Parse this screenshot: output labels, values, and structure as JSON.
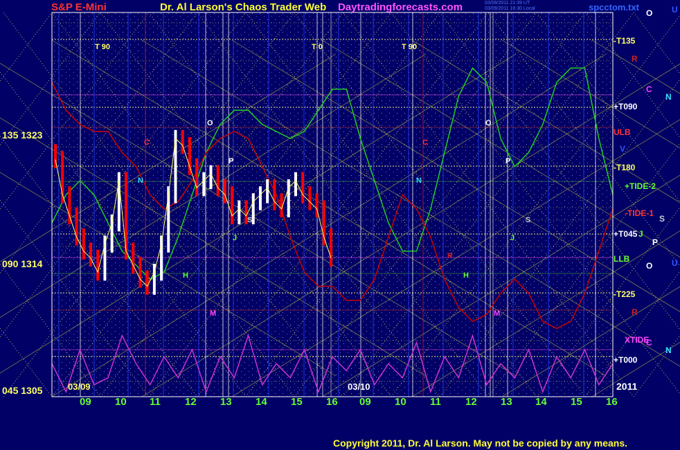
{
  "header": {
    "instrument": "S&P E-Mini",
    "title": "Dr. Al Larson's Chaos Trader Web",
    "site": "Daytradingforecasts.com",
    "stamp1": "03/09/2011 21:39 UT",
    "stamp2": "03/09/2011 16:30 Local",
    "file": "spcctom.txt",
    "year": "2011"
  },
  "copyright": "Copyright 2011, Dr. Al Larson. May not be copied by any means.",
  "colors": {
    "background": "#000066",
    "price_up": "#ffffff",
    "price_down": "#ff0000",
    "grid": "#ffff66",
    "tide1": "#cc0000",
    "tide2": "#22cc22",
    "xtide": "#cc33cc"
  },
  "chart_data": {
    "type": "line",
    "y_axis_left": [
      "135  1323",
      "090  1314",
      "045  1305"
    ],
    "x_ticks": [
      "09",
      "10",
      "11",
      "12",
      "13",
      "14",
      "15",
      "16",
      "09",
      "10",
      "11",
      "12",
      "13",
      "14",
      "15",
      "16"
    ],
    "date_labels": [
      "03/09",
      "03/10"
    ],
    "right_labels": [
      "-T135",
      "+T090",
      "ULB",
      "-T180",
      "+TIDE-2",
      "-TIDE-1",
      "+T045",
      "LLB",
      "-T225",
      "XTIDE",
      "+T000"
    ],
    "planet_codes_right": [
      "U",
      "O",
      "R",
      "C",
      "N",
      "V",
      "S",
      "J",
      "P",
      "O",
      "U",
      "R",
      "C",
      "N"
    ],
    "planet_codes_chart": [
      "C",
      "N",
      "H",
      "M",
      "O",
      "P",
      "S",
      "J",
      "C",
      "N",
      "R",
      "H",
      "M",
      "O",
      "P",
      "S",
      "J",
      "T  90",
      "T  0",
      "T  90"
    ],
    "series": [
      {
        "name": "S&P E-Mini",
        "values": [
          1321.5,
          1319,
          1317.5,
          1316,
          1315,
          1314.5,
          1313.5,
          1315.5,
          1317,
          1320,
          1315,
          1314,
          1313,
          1312.5,
          1313.5,
          1315.5,
          1319,
          1323,
          1322.5,
          1321,
          1319.5,
          1320,
          1320.5,
          1319.5,
          1319,
          1317.5,
          1318,
          1317.5,
          1318.5,
          1319,
          1319.5,
          1318.5,
          1318,
          1319.5,
          1320,
          1319,
          1318.5,
          1318,
          1316,
          1314.5
        ]
      },
      {
        "name": "+TIDE-2",
        "values": [
          1317,
          1319,
          1320,
          1319,
          1317,
          1315,
          1314,
          1313,
          1313.5,
          1316,
          1319,
          1322,
          1324,
          1325,
          1325,
          1324,
          1323.5,
          1323,
          1323.5,
          1325,
          1326.5,
          1326.5,
          1323,
          1320,
          1317,
          1315,
          1315,
          1318,
          1322,
          1326,
          1328,
          1327,
          1323,
          1321,
          1322,
          1324,
          1327,
          1328,
          1328,
          1323,
          1319
        ]
      },
      {
        "name": "-TIDE-1",
        "values": [
          1327,
          1325,
          1324,
          1323.5,
          1323.5,
          1322,
          1321,
          1319,
          1318,
          1318.5,
          1320,
          1322,
          1323,
          1323.5,
          1323,
          1321,
          1319,
          1316,
          1313.5,
          1312.5,
          1312.5,
          1311.5,
          1311.5,
          1313,
          1316,
          1319,
          1318,
          1316,
          1313,
          1311,
          1310,
          1310.5,
          1312,
          1313,
          1312,
          1310,
          1309.5,
          1310,
          1312,
          1315,
          1318
        ]
      },
      {
        "name": "XTIDE",
        "values": [
          1307,
          1305,
          1308,
          1305.5,
          1306,
          1309,
          1307,
          1305.5,
          1307.5,
          1306,
          1308,
          1305,
          1307.5,
          1306,
          1309,
          1305.5,
          1307,
          1306,
          1308,
          1305,
          1307.5,
          1306.5,
          1308,
          1305.5,
          1307,
          1306,
          1308.5,
          1305,
          1307.5,
          1306,
          1309,
          1305.5,
          1307,
          1306,
          1308,
          1305,
          1307.5,
          1306,
          1308,
          1305.5,
          1307
        ]
      }
    ]
  }
}
